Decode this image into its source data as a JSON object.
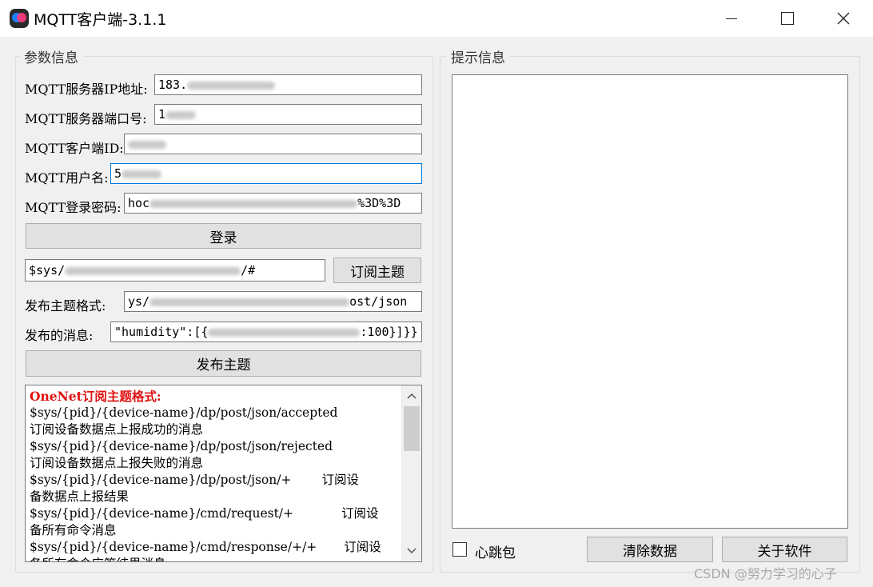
{
  "window": {
    "title": "MQTT客户端-3.1.1",
    "minimize_icon": "minimize-icon",
    "maximize_icon": "maximize-icon",
    "close_icon": "close-icon"
  },
  "params": {
    "group_title": "参数信息",
    "ip_label": "MQTT服务器IP地址:",
    "ip_value": "183.",
    "port_label": "MQTT服务器端口号:",
    "port_value": "1",
    "client_id_label": "MQTT客户端ID:",
    "client_id_value": "",
    "username_label": "MQTT用户名:",
    "username_value": "5",
    "password_label": "MQTT登录密码:",
    "password_value": "hoc",
    "password_tail": "%3D%3D",
    "login_button": "登录",
    "subscribe_topic_value": "$sys/",
    "subscribe_topic_tail": "/#",
    "subscribe_button": "订阅主题",
    "publish_format_label": "发布主题格式:",
    "publish_format_value": "ys/",
    "publish_format_tail": "ost/json",
    "publish_message_label": "发布的消息:",
    "publish_message_value": "\"humidity\":[{",
    "publish_message_tail": ":100}]}}",
    "publish_button": "发布主题"
  },
  "help_text": {
    "heading": "OneNet订阅主题格式:",
    "lines": [
      "$sys/{pid}/{device-name}/dp/post/json/accepted",
      "订阅设备数据点上报成功的消息",
      "$sys/{pid}/{device-name}/dp/post/json/rejected",
      "订阅设备数据点上报失败的消息",
      "$sys/{pid}/{device-name}/dp/post/json/+",
      "备数据点上报结果",
      "$sys/{pid}/{device-name}/cmd/request/+",
      "备所有命令消息",
      "$sys/{pid}/{device-name}/cmd/response/+/+",
      "各所有命令应答结果消息"
    ],
    "tab_suffix": "订阅设"
  },
  "hints": {
    "group_title": "提示信息",
    "log_text": "",
    "heartbeat_label": "心跳包",
    "heartbeat_checked": false,
    "clear_button": "清除数据",
    "about_button": "关于软件"
  },
  "watermark": "CSDN @努力学习的心子",
  "colors": {
    "heading_red": "#e01010",
    "focus_blue": "#0078d7"
  }
}
